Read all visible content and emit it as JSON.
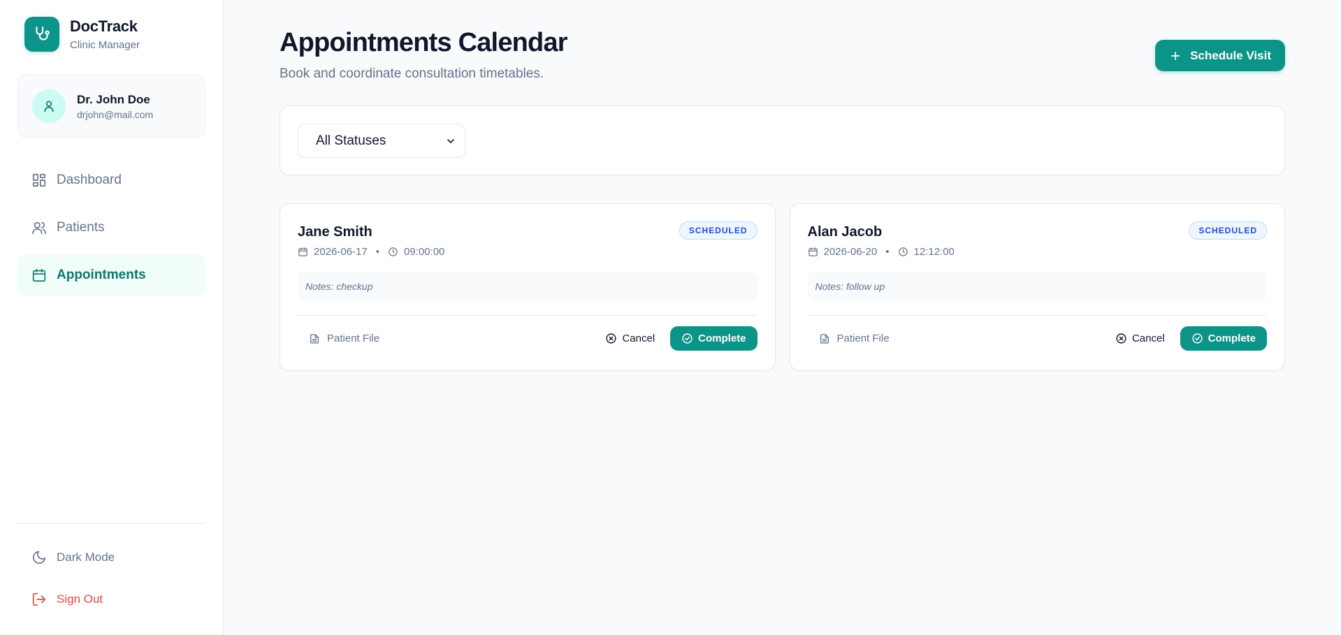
{
  "brand": {
    "name": "DocTrack",
    "subtitle": "Clinic Manager"
  },
  "user": {
    "name": "Dr. John Doe",
    "email": "drjohn@mail.com"
  },
  "nav": {
    "items": [
      {
        "label": "Dashboard",
        "icon": "layout-grid-icon",
        "active": false
      },
      {
        "label": "Patients",
        "icon": "users-icon",
        "active": false
      },
      {
        "label": "Appointments",
        "icon": "calendar-icon",
        "active": true
      }
    ]
  },
  "sidebar_bottom": {
    "dark_mode_label": "Dark Mode",
    "sign_out_label": "Sign Out"
  },
  "header": {
    "title": "Appointments Calendar",
    "subtitle": "Book and coordinate consultation timetables.",
    "schedule_button_label": "Schedule Visit"
  },
  "filter": {
    "status_selected": "All Statuses"
  },
  "appointments": [
    {
      "patient": "Jane Smith",
      "status": "SCHEDULED",
      "date": "2026-06-17",
      "time": "09:00:00",
      "notes": "Notes: checkup",
      "file_label": "Patient File",
      "cancel_label": "Cancel",
      "complete_label": "Complete"
    },
    {
      "patient": "Alan Jacob",
      "status": "SCHEDULED",
      "date": "2026-06-20",
      "time": "12:12:00",
      "notes": "Notes: follow up",
      "file_label": "Patient File",
      "cancel_label": "Cancel",
      "complete_label": "Complete"
    }
  ],
  "colors": {
    "accent": "#0d9488",
    "accent_text": "#0f766e",
    "active_nav_bg": "#f0fdf9",
    "badge_bg": "#eff6ff",
    "badge_text": "#1d4ed8",
    "danger": "#ef4444"
  }
}
